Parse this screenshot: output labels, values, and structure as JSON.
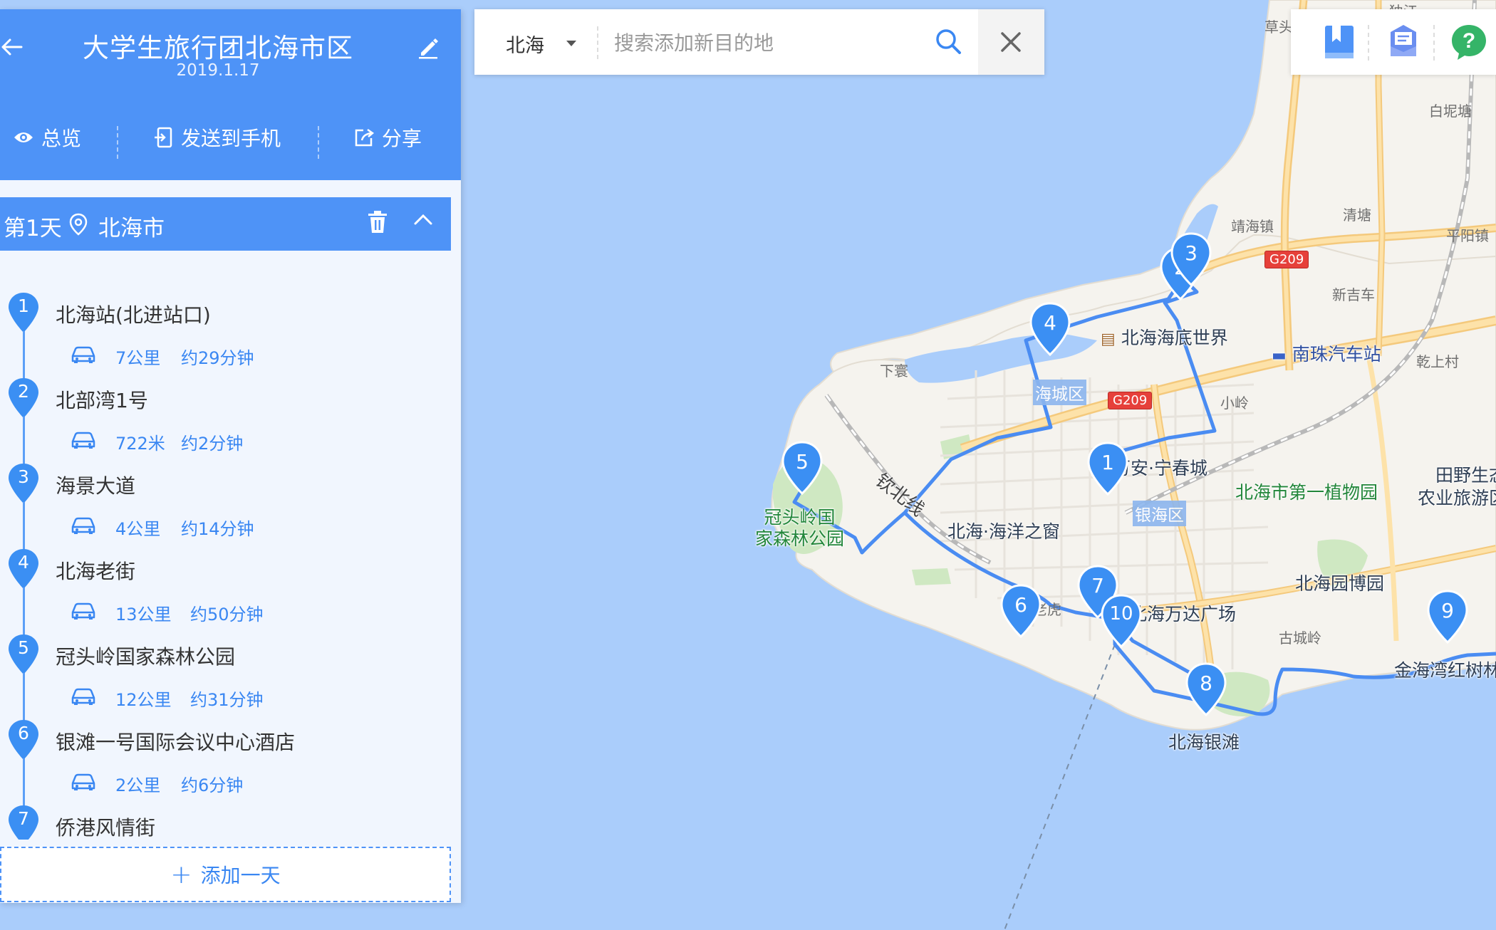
{
  "trip": {
    "title": "大学生旅行团北海市区",
    "date": "2019.1.17",
    "actions": {
      "overview": "总览",
      "send_to_phone": "发送到手机",
      "share": "分享"
    }
  },
  "day": {
    "label": "第1天",
    "city": "北海市"
  },
  "stops": [
    {
      "num": "1",
      "name": "北海站(北进站口)",
      "dist": "7公里",
      "time": "约29分钟"
    },
    {
      "num": "2",
      "name": "北部湾1号",
      "dist": "722米",
      "time": "约2分钟"
    },
    {
      "num": "3",
      "name": "海景大道",
      "dist": "4公里",
      "time": "约14分钟"
    },
    {
      "num": "4",
      "name": "北海老街",
      "dist": "13公里",
      "time": "约50分钟"
    },
    {
      "num": "5",
      "name": "冠头岭国家森林公园",
      "dist": "12公里",
      "time": "约31分钟"
    },
    {
      "num": "6",
      "name": "银滩一号国际会议中心酒店",
      "dist": "2公里",
      "time": "约6分钟"
    },
    {
      "num": "7",
      "name": "侨港风情街"
    }
  ],
  "add_day": "添加一天",
  "search": {
    "city": "北海",
    "placeholder": "搜索添加新目的地"
  },
  "map": {
    "labels": {
      "caotou": "草头",
      "baiputang": "白坭塘",
      "qingtang": "清塘",
      "jinghai": "靖海镇",
      "pingyang": "平阳镇",
      "xinjiche": "新吉车",
      "ganshang": "乾上村",
      "xiagan": "下寰",
      "xiaoling": "小岭",
      "gucheng": "古城岭",
      "laohu": "老虎",
      "top_frag": "独江"
    },
    "pois": {
      "haidi": "北海海底世界",
      "nanzhu": "南珠汽车站",
      "ningchun": "万安·宁春城",
      "zhiwuyuan": "北海市第一植物园",
      "tianye": "田野生态\n农业旅游区",
      "guantou": "冠头岭国\n家森林公园",
      "haiyang": "北海·海洋之窗",
      "wanda": "北海万达广场",
      "yuanbo": "北海园博园",
      "jinhaiwan": "金海湾红树林",
      "yintan": "北海银滩"
    },
    "districts": {
      "haicheng": "海城区",
      "yinhai": "银海区"
    },
    "roads": {
      "g209_a": "G209",
      "g209_b": "G209"
    },
    "railway": "钦北线",
    "markers": [
      "1",
      "2",
      "3",
      "4",
      "5",
      "6",
      "7",
      "8",
      "9",
      "10"
    ]
  },
  "colors": {
    "primary": "#4e93f7",
    "route": "#4a8cf2",
    "sea": "#aacdfb",
    "land": "#f5f3ee"
  },
  "icons": [
    "back-arrow-icon",
    "edit-icon",
    "eye-icon",
    "send-phone-icon",
    "share-icon",
    "location-pin-icon",
    "trash-icon",
    "chevron-up-icon",
    "car-icon",
    "search-icon",
    "close-icon",
    "bookmark-icon",
    "message-icon",
    "help-icon",
    "caret-down-icon"
  ]
}
